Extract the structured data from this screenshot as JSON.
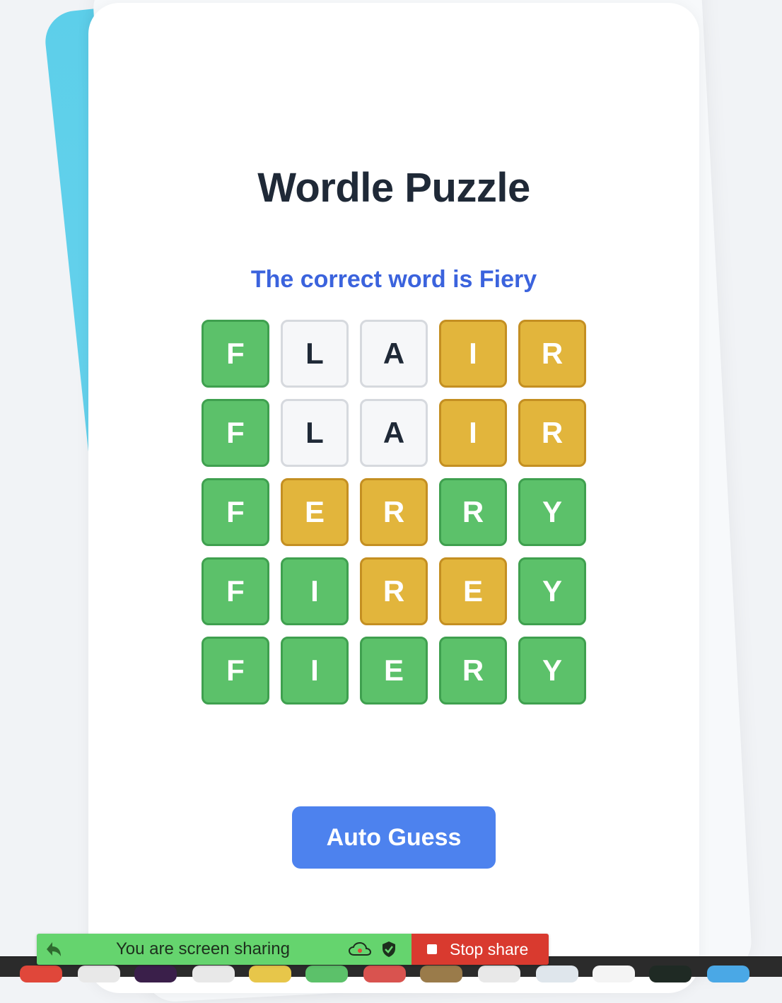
{
  "page": {
    "title": "Wordle Puzzle",
    "message": "The correct word is Fiery"
  },
  "grid": [
    [
      {
        "letter": "F",
        "state": "green"
      },
      {
        "letter": "L",
        "state": "empty"
      },
      {
        "letter": "A",
        "state": "empty"
      },
      {
        "letter": "I",
        "state": "yellow"
      },
      {
        "letter": "R",
        "state": "yellow"
      }
    ],
    [
      {
        "letter": "F",
        "state": "green"
      },
      {
        "letter": "L",
        "state": "empty"
      },
      {
        "letter": "A",
        "state": "empty"
      },
      {
        "letter": "I",
        "state": "yellow"
      },
      {
        "letter": "R",
        "state": "yellow"
      }
    ],
    [
      {
        "letter": "F",
        "state": "green"
      },
      {
        "letter": "E",
        "state": "yellow"
      },
      {
        "letter": "R",
        "state": "yellow"
      },
      {
        "letter": "R",
        "state": "green"
      },
      {
        "letter": "Y",
        "state": "green"
      }
    ],
    [
      {
        "letter": "F",
        "state": "green"
      },
      {
        "letter": "I",
        "state": "green"
      },
      {
        "letter": "R",
        "state": "yellow"
      },
      {
        "letter": "E",
        "state": "yellow"
      },
      {
        "letter": "Y",
        "state": "green"
      }
    ],
    [
      {
        "letter": "F",
        "state": "green"
      },
      {
        "letter": "I",
        "state": "green"
      },
      {
        "letter": "E",
        "state": "green"
      },
      {
        "letter": "R",
        "state": "green"
      },
      {
        "letter": "Y",
        "state": "green"
      }
    ]
  ],
  "buttons": {
    "auto_guess": "Auto Guess"
  },
  "share_bar": {
    "status": "You are screen sharing",
    "stop_label": "Stop share"
  },
  "colors": {
    "green": "#5cc16a",
    "yellow": "#e2b53c",
    "button": "#4d82ee",
    "message": "#3b63dd"
  },
  "dock_icons": [
    "chrome-icon",
    "finder-icon",
    "podcast-icon",
    "app-icon",
    "notes-icon",
    "messages-icon",
    "calendar-icon",
    "app-icon",
    "app-icon",
    "app-icon",
    "app-icon",
    "terminal-icon",
    "app-icon"
  ]
}
